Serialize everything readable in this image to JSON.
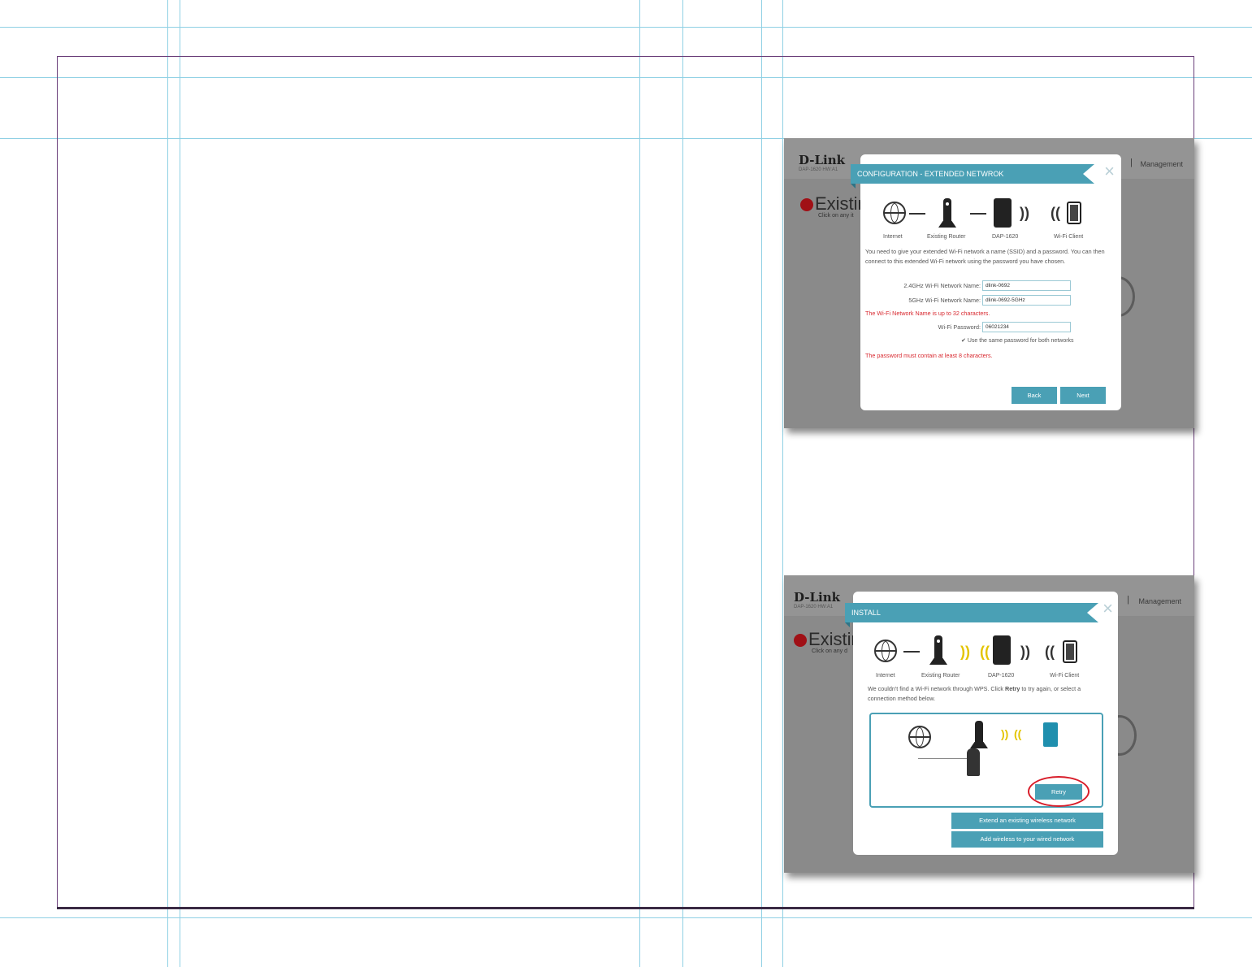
{
  "shot1": {
    "logo": "D-Link",
    "logo_sub": "DAP-1620 HW:A1",
    "nav_sep": "|",
    "nav_item": "Management",
    "heading": "Existin",
    "hint": "Click on any it",
    "modal": {
      "title": "CONFIGURATION - EXTENDED NETWROK",
      "close": "×",
      "captions": [
        "Internet",
        "Existing Router",
        "DAP-1620",
        "Wi-Fi Client"
      ],
      "description": "You need to give your extended Wi-Fi network a name (SSID) and a password. You can then connect to this extended Wi-Fi network using the password you have chosen.",
      "fields": {
        "ssid24_label": "2.4GHz Wi-Fi Network Name:",
        "ssid24_value": "dlink-0692",
        "ssid5_label": "5GHz Wi-Fi Network Name:",
        "ssid5_value": "dlink-0692-5GHz",
        "ssid_warning": "The Wi-Fi Network Name is up to 32 characters.",
        "password_label": "Wi-Fi Password:",
        "password_value": "06021234",
        "same_password": "Use the same password for both networks",
        "password_warning": "The password must contain at least 8 characters."
      },
      "back_label": "Back",
      "next_label": "Next"
    }
  },
  "shot2": {
    "logo": "D-Link",
    "logo_sub": "DAP-1620 HW:A1",
    "nav_sep": "|",
    "nav_item": "Management",
    "heading": "Existin",
    "hint": "Click on any d",
    "modal": {
      "title": "INSTALL",
      "close": "×",
      "captions": [
        "Internet",
        "Existing Router",
        "DAP-1620",
        "Wi-Fi Client"
      ],
      "description_pre": "We couldn't find a Wi-Fi network through WPS. Click ",
      "description_bold": "Retry",
      "description_post": " to try again, or select a connection method below.",
      "retry_label": "Retry",
      "extend_label": "Extend an existing wireless network",
      "wired_label": "Add wireless to your wired network"
    }
  },
  "colors": {
    "accent": "#4aa0b5",
    "warning": "#d8282f",
    "highlight_ring": "#d81d2a",
    "overlay": "#8a8a8a"
  }
}
